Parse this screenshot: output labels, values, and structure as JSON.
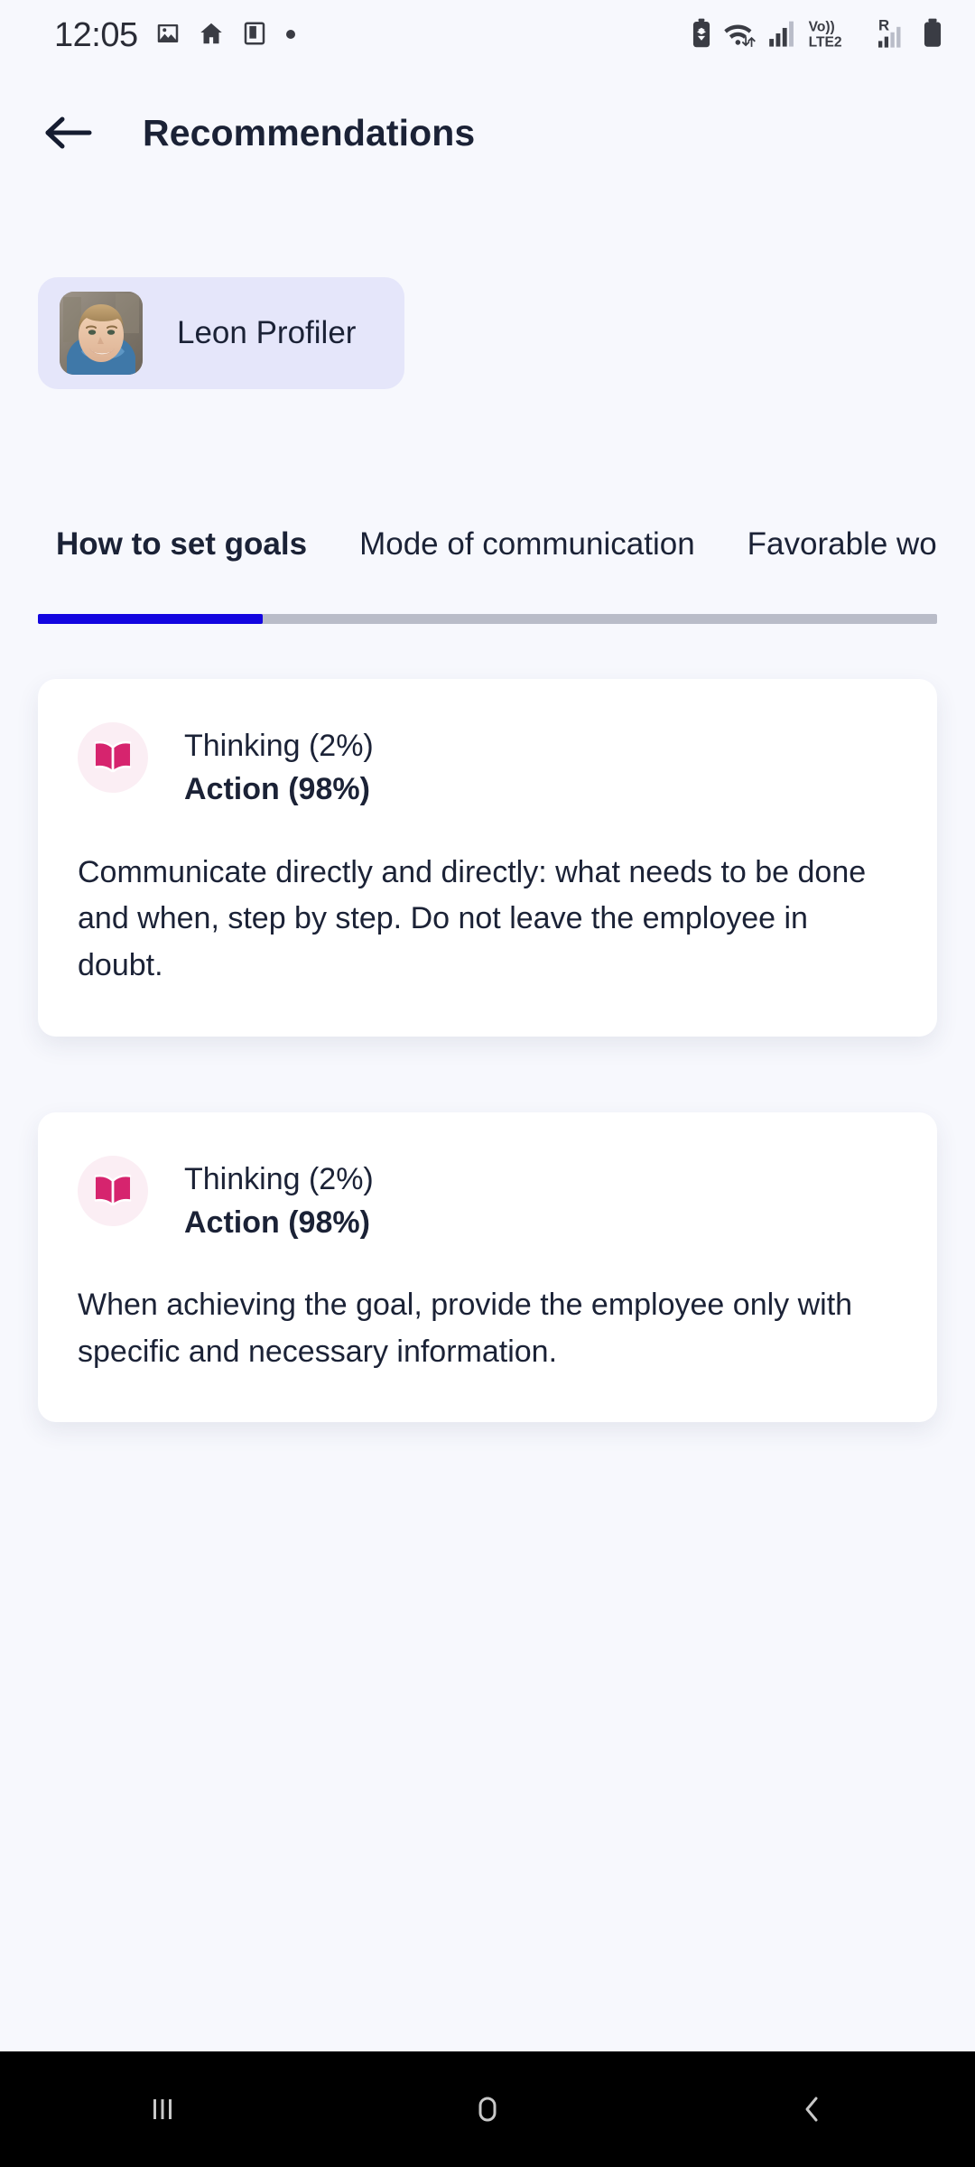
{
  "status_bar": {
    "time": "12:05",
    "left_icons": [
      "image-icon",
      "home-icon",
      "app-window-icon",
      "dot-icon"
    ],
    "right_icons": [
      "battery-saver-icon",
      "wifi-icon",
      "signal-bars-icon",
      "volte-lte2-icon",
      "roaming-signal-icon",
      "battery-icon"
    ],
    "network_label_top": "Vo))",
    "network_label_bottom": "LTE2",
    "roaming_label": "R"
  },
  "header": {
    "back_label": "Back",
    "title": "Recommendations"
  },
  "profile": {
    "name": "Leon Profiler",
    "avatar_alt": "portrait of smiling man",
    "chip_color": "#e5e6fa"
  },
  "tabs": {
    "items": [
      {
        "label": "How to set goals",
        "active": true
      },
      {
        "label": "Mode of communication",
        "active": false
      },
      {
        "label": "Favorable wo",
        "active": false
      }
    ]
  },
  "scroll_indicator": {
    "fill_percent": 25,
    "fill_color": "#1305e0",
    "track_color": "#b9bcc8"
  },
  "cards": [
    {
      "icon": "open-book-icon",
      "icon_color": "#d6246e",
      "icon_bg": "#fbeef4",
      "line1": "Thinking (2%)",
      "line2": "Action (98%)",
      "body": " Communicate directly and directly: what needs to be done and when, step by step. Do not leave the employee in doubt."
    },
    {
      "icon": "open-book-icon",
      "icon_color": "#d6246e",
      "icon_bg": "#fbeef4",
      "line1": "Thinking (2%)",
      "line2": "Action (98%)",
      "body": " When achieving the goal, provide the employee only with specific and necessary information."
    }
  ],
  "nav_bar": {
    "recents_label": "Recents",
    "home_label": "Home",
    "back_label": "Back"
  },
  "colors": {
    "page_background": "#f7f8fd",
    "card_background": "#ffffff",
    "text_primary": "#1b2236",
    "accent_blue": "#1305e0",
    "accent_pink": "#d6246e"
  }
}
